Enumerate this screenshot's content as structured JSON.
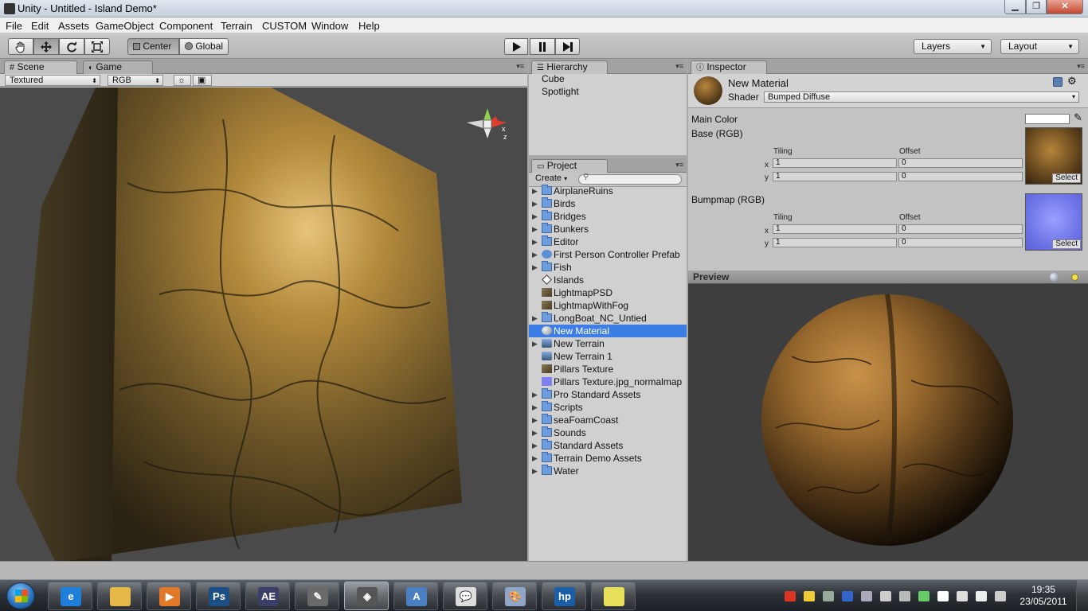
{
  "window": {
    "title": "Unity - Untitled - Island Demo*",
    "minimize_icon": "minimize-icon",
    "maximize_icon": "maximize-icon",
    "close_icon": "close-icon"
  },
  "menubar": {
    "items": [
      "File",
      "Edit",
      "Assets",
      "GameObject",
      "Component",
      "Terrain",
      "CUSTOM",
      "Window",
      "Help"
    ]
  },
  "toolbar": {
    "tools": [
      "hand-icon",
      "move-icon",
      "rotate-icon",
      "scale-icon"
    ],
    "pivot_label": "Center",
    "space_label": "Global",
    "play_icon": "play-icon",
    "pause_icon": "pause-icon",
    "step_icon": "step-icon",
    "layers_label": "Layers",
    "layout_label": "Layout"
  },
  "scene": {
    "tab_scene": "Scene",
    "tab_game": "Game",
    "render_mode": "Textured",
    "color_mode": "RGB",
    "gizmo_axis_z": "z",
    "gizmo_axis_x": "x"
  },
  "hierarchy": {
    "tab_label": "Hierarchy",
    "items": [
      "Cube",
      "Spotlight"
    ]
  },
  "project": {
    "tab_label": "Project",
    "create_label": "Create",
    "search_placeholder": "",
    "items": [
      {
        "label": "AirplaneRuins",
        "icon": "folder-icon",
        "foldout": true
      },
      {
        "label": "Birds",
        "icon": "folder-icon",
        "foldout": true
      },
      {
        "label": "Bridges",
        "icon": "folder-icon",
        "foldout": true
      },
      {
        "label": "Bunkers",
        "icon": "folder-icon",
        "foldout": true
      },
      {
        "label": "Editor",
        "icon": "folder-icon",
        "foldout": true
      },
      {
        "label": "First Person Controller Prefab",
        "icon": "prefab-icon",
        "foldout": true
      },
      {
        "label": "Fish",
        "icon": "folder-icon",
        "foldout": true
      },
      {
        "label": "Islands",
        "icon": "unity-scene-icon",
        "foldout": false
      },
      {
        "label": "LightmapPSD",
        "icon": "texture-icon",
        "foldout": false
      },
      {
        "label": "LightmapWithFog",
        "icon": "texture-icon",
        "foldout": false
      },
      {
        "label": "LongBoat_NC_Untied",
        "icon": "folder-icon",
        "foldout": true
      },
      {
        "label": "New Material",
        "icon": "material-icon",
        "foldout": false,
        "selected": true
      },
      {
        "label": "New Terrain",
        "icon": "terrain-icon",
        "foldout": true
      },
      {
        "label": "New Terrain 1",
        "icon": "terrain-icon",
        "foldout": false
      },
      {
        "label": "Pillars Texture",
        "icon": "texture-icon",
        "foldout": false
      },
      {
        "label": "Pillars Texture.jpg_normalmap",
        "icon": "normalmap-icon",
        "foldout": false
      },
      {
        "label": "Pro Standard Assets",
        "icon": "folder-icon",
        "foldout": true
      },
      {
        "label": "Scripts",
        "icon": "folder-icon",
        "foldout": true
      },
      {
        "label": "seaFoamCoast",
        "icon": "folder-icon",
        "foldout": true
      },
      {
        "label": "Sounds",
        "icon": "folder-icon",
        "foldout": true
      },
      {
        "label": "Standard Assets",
        "icon": "folder-icon",
        "foldout": true
      },
      {
        "label": "Terrain Demo Assets",
        "icon": "folder-icon",
        "foldout": true
      },
      {
        "label": "Water",
        "icon": "folder-icon",
        "foldout": true
      }
    ]
  },
  "inspector": {
    "tab_label": "Inspector",
    "material_name": "New Material",
    "shader_label": "Shader",
    "shader_value": "Bumped Diffuse",
    "main_color_label": "Main Color",
    "main_color_value": "#ffffff",
    "base": {
      "label": "Base (RGB)",
      "tiling_label": "Tiling",
      "offset_label": "Offset",
      "x_label": "x",
      "y_label": "y",
      "tiling_x": "1",
      "tiling_y": "1",
      "offset_x": "0",
      "offset_y": "0",
      "select_label": "Select"
    },
    "bumpmap": {
      "label": "Bumpmap (RGB)",
      "tiling_label": "Tiling",
      "offset_label": "Offset",
      "x_label": "x",
      "y_label": "y",
      "tiling_x": "1",
      "tiling_y": "1",
      "offset_x": "0",
      "offset_y": "0",
      "select_label": "Select"
    }
  },
  "preview": {
    "label": "Preview"
  },
  "taskbar": {
    "apps": [
      {
        "name": "internet-explorer-icon",
        "glyph": "e",
        "color": "#1f7fd8"
      },
      {
        "name": "explorer-icon",
        "glyph": "",
        "color": "#e6b84a"
      },
      {
        "name": "media-player-icon",
        "glyph": "▶",
        "color": "#e07a2a"
      },
      {
        "name": "photoshop-icon",
        "glyph": "Ps",
        "color": "#1b4f86"
      },
      {
        "name": "after-effects-icon",
        "glyph": "AE",
        "color": "#3b3f68"
      },
      {
        "name": "inkscape-icon",
        "glyph": "✎",
        "color": "#6a6a6a"
      },
      {
        "name": "unity-icon",
        "glyph": "◈",
        "color": "#555555",
        "active": true
      },
      {
        "name": "wordpad-icon",
        "glyph": "A",
        "color": "#4a7fc1"
      },
      {
        "name": "messenger-icon",
        "glyph": "💬",
        "color": "#dddddd"
      },
      {
        "name": "paint-icon",
        "glyph": "🎨",
        "color": "#8fa6c8"
      },
      {
        "name": "hp-icon",
        "glyph": "hp",
        "color": "#1a5ea8"
      },
      {
        "name": "sticky-notes-icon",
        "glyph": "",
        "color": "#e8e05a"
      }
    ],
    "time": "19:35",
    "date": "23/05/2011"
  }
}
